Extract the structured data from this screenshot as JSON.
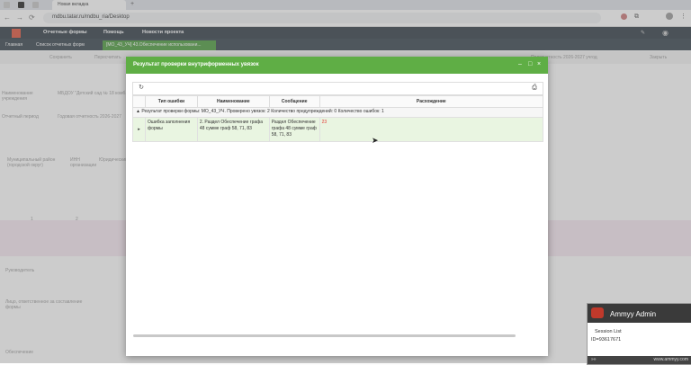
{
  "browser": {
    "tab_title": "Новая вкладка",
    "url": "mdbu.tatar.ru/mdbu_ria/Desktop"
  },
  "app_nav": {
    "items": [
      "Отчетные формы",
      "Помощь",
      "Новости проекта"
    ]
  },
  "doc_tabs": {
    "items": [
      "Главная",
      "Список отчетных форм",
      "[МО_43_УЧ] 43.Обеспечение использовани..."
    ]
  },
  "background": {
    "toolbar": [
      "Сохранить",
      "Пересчитать",
      "Подотчетность 2026-2027 учгод",
      "Закрыть"
    ],
    "fields": [
      {
        "label": "Наименование учреждения",
        "value": "МБДОУ \"Детский сад № 18 комб..."
      },
      {
        "label": "Отчетный период",
        "value": "Годовая отчетность 2026-2027"
      }
    ],
    "table_headers": [
      "Муниципальный район (городской округ)",
      "ИНН организации",
      "Юридический"
    ],
    "table_numbers": [
      "1",
      "2"
    ],
    "footer_labels": [
      "Руководитель",
      "Лицо, ответственное за составление формы",
      "Обеспечение"
    ]
  },
  "modal": {
    "title": "Результат проверки внутриформенных увязок",
    "columns": [
      "Тип ошибки",
      "Наименование",
      "Сообщение",
      "Расхождение"
    ],
    "group_row": "Результат проверки формы: МО_43_УЧ. Проверено увязок: 2 Количество предупреждений: 0 Количество ошибок: 1",
    "rows": [
      {
        "type": "Ошибка заполнения формы",
        "name": "2. Раздел Обеспечение графа 48 сумме граф 58, 71, 83",
        "message": "Раздел Обеспечение графа 48 сумме граф 58, 71, 83",
        "discrepancy": "23"
      }
    ]
  },
  "ammyy": {
    "title": "Ammyy Admin",
    "session": "Session List",
    "id": "ID=93617671",
    "site": "www.ammyy.com"
  },
  "colors": {
    "modal_header": "#5fae45",
    "row_highlight": "#e9f5e1",
    "discrepancy_red": "#e53935",
    "nav_bg": "#2f3b44"
  }
}
